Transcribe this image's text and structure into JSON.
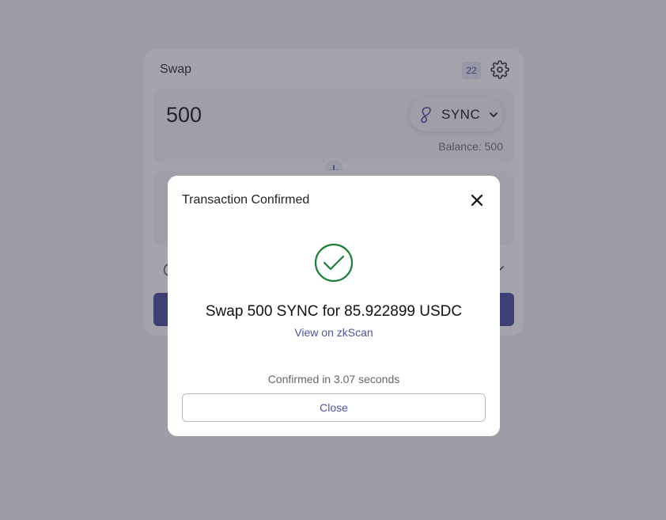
{
  "swap": {
    "title": "Swap",
    "badge": "22",
    "from": {
      "amount": "500",
      "token": "SYNC",
      "balance": "Balance: 500"
    }
  },
  "modal": {
    "title": "Transaction Confirmed",
    "message": "Swap 500 SYNC for 85.922899 USDC",
    "link_label": "View on zkScan",
    "confirmed_text": "Confirmed in 3.07 seconds",
    "close_label": "Close"
  },
  "icons": {
    "settings": "gear-icon",
    "token_logo": "sync-token-logo-icon",
    "dropdown": "chevron-down-icon",
    "swap_direction": "arrow-down-icon",
    "info": "info-icon",
    "route_status": "check-icon",
    "close": "close-icon",
    "success": "check-circle-icon"
  },
  "colors": {
    "accent": "#4f52a0",
    "success": "#1e7d3a",
    "panel": "#f6f6f7",
    "overlay": "rgba(40,38,58,0.42)"
  }
}
